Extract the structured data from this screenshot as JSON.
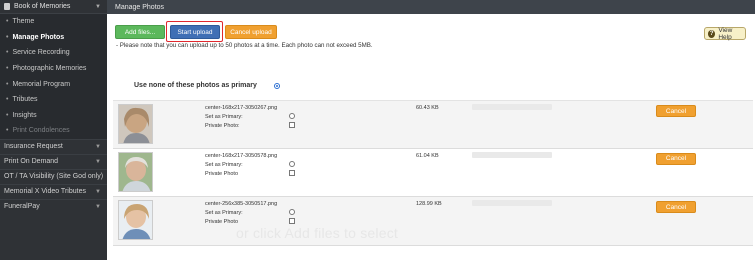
{
  "sidebar": {
    "section": {
      "label": "Book of Memories"
    },
    "subitems": [
      {
        "label": "Theme"
      },
      {
        "label": "Manage Photos"
      },
      {
        "label": "Service Recording"
      },
      {
        "label": "Photographic Memories"
      },
      {
        "label": "Memorial Program"
      },
      {
        "label": "Tributes"
      },
      {
        "label": "Insights"
      },
      {
        "label": "Print Condolences"
      }
    ],
    "items": [
      {
        "label": "Insurance Request"
      },
      {
        "label": "Print On Demand"
      },
      {
        "label": "OT / TA Visibility (Site God only)"
      },
      {
        "label": "Memorial X Video Tributes"
      },
      {
        "label": "FuneralPay"
      }
    ]
  },
  "header": {
    "title": "Manage Photos"
  },
  "toolbar": {
    "add_label": "Add files...",
    "start_label": "Start upload",
    "cancel_label": "Cancel upload",
    "help_label": "View Help"
  },
  "note": "- Please note that you can upload up to 50 photos at a time. Each photo can not exceed 5MB.",
  "primary_option": {
    "label": "Use none of these photos as primary",
    "selected": true
  },
  "file_labels": {
    "primary": "Set as Primary:",
    "private": "Private Photo",
    "private_first": "Private Photo:"
  },
  "files": [
    {
      "name": "center-168x217-3050267.png",
      "size": "60.43 KB",
      "cancel": "Cancel"
    },
    {
      "name": "center-168x217-3050578.png",
      "size": "61.04 KB",
      "cancel": "Cancel"
    },
    {
      "name": "center-256x385-3050517.png",
      "size": "128.99 KB",
      "cancel": "Cancel"
    }
  ],
  "dropzone": "or click Add files to select",
  "colors": {
    "accent_orange": "#f0a030",
    "start_blue": "#3f6fb5",
    "add_green": "#5cb85c",
    "sidebar_bg": "#2f3236"
  }
}
